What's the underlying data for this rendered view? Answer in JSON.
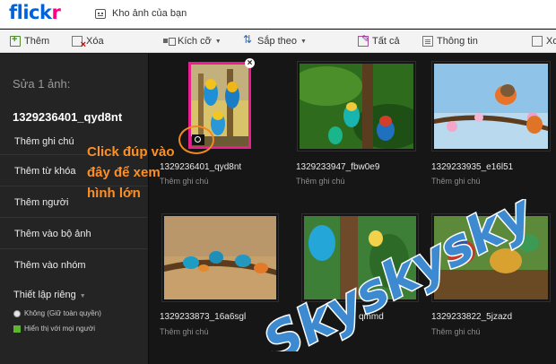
{
  "header": {
    "logo_part1": "flick",
    "logo_part2": "r",
    "page_title": "Kho ảnh của bạn"
  },
  "toolbar": {
    "add": "Thêm",
    "delete": "Xóa",
    "size": "Kích cỡ",
    "sort": "Sắp theo",
    "all": "Tất cả",
    "info": "Thông tin",
    "close_partial": "Xo"
  },
  "sidebar": {
    "heading": "Sửa 1 ảnh:",
    "photo_name": "1329236401_qyd8nt",
    "items": [
      "Thêm ghi chú",
      "Thêm từ khóa",
      "Thêm người",
      "Thêm vào bộ ảnh",
      "Thêm vào nhóm"
    ],
    "privacy_label": "Thiết lập riêng",
    "privacy_options": [
      "Không (Giữ toàn quyền)",
      "Hiển thị với mọi người"
    ]
  },
  "photos": [
    {
      "title": "1329236401_qyd8nt",
      "note": "Thêm ghi chú"
    },
    {
      "title": "1329233947_fbw0e9",
      "note": "Thêm ghi chú"
    },
    {
      "title": "1329233935_e16l51",
      "note": "Thêm ghi chú"
    },
    {
      "title": "1329233873_16a6sgl",
      "note": "Thêm ghi chú"
    },
    {
      "title": "qmmd",
      "note": "Thêm ghi chú"
    },
    {
      "title": "1329233822_5jzazd",
      "note": "Thêm ghi chú"
    }
  ],
  "annotation": {
    "line1": "Click đúp vào",
    "line2": "đây để xem",
    "line3": "hình lớn"
  },
  "watermark_text": "Skyskysky",
  "colors": {
    "flickr_blue": "#0063dc",
    "flickr_pink": "#ff0084",
    "selection": "#ec1d8f",
    "annotation": "#ff8f22"
  }
}
